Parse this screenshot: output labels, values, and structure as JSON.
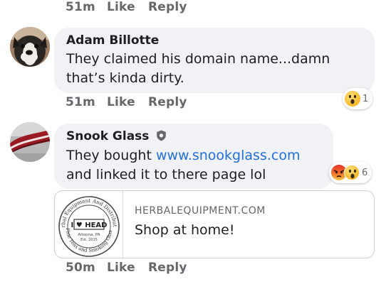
{
  "top_actions": {
    "time": "51m",
    "like": "Like",
    "reply": "Reply"
  },
  "comments": [
    {
      "author": "Adam Billotte",
      "text": "They claimed his domain name...damn that’s kinda dirty.",
      "time": "51m",
      "like": "Like",
      "reply": "Reply",
      "reactions": {
        "types": [
          "wow"
        ],
        "count": "1"
      }
    },
    {
      "author": "Snook Glass",
      "text_before": "They bought ",
      "link": "www.snookglass.com",
      "text_after": " and linked it to there page lol",
      "verified_icon": "shield-badge-icon",
      "reactions": {
        "types": [
          "angry",
          "wow"
        ],
        "count": "6"
      },
      "link_preview": {
        "domain": "HERBALEQUIPMENT.COM",
        "title": "Shop at home!",
        "logo_text_top": "Herbal Equipment And Distribution",
        "logo_center": "I ♥ HEAD",
        "logo_city": "Altoona, PA",
        "logo_est": "Est. 2015",
        "logo_text_bottom": "Fine Teas and Smoking Glass"
      },
      "time": "50m",
      "like": "Like",
      "reply": "Reply"
    }
  ],
  "colors": {
    "bubble": "#f0f2f5",
    "link": "#216fdb",
    "meta": "#65676b",
    "text": "#1c1e21"
  }
}
